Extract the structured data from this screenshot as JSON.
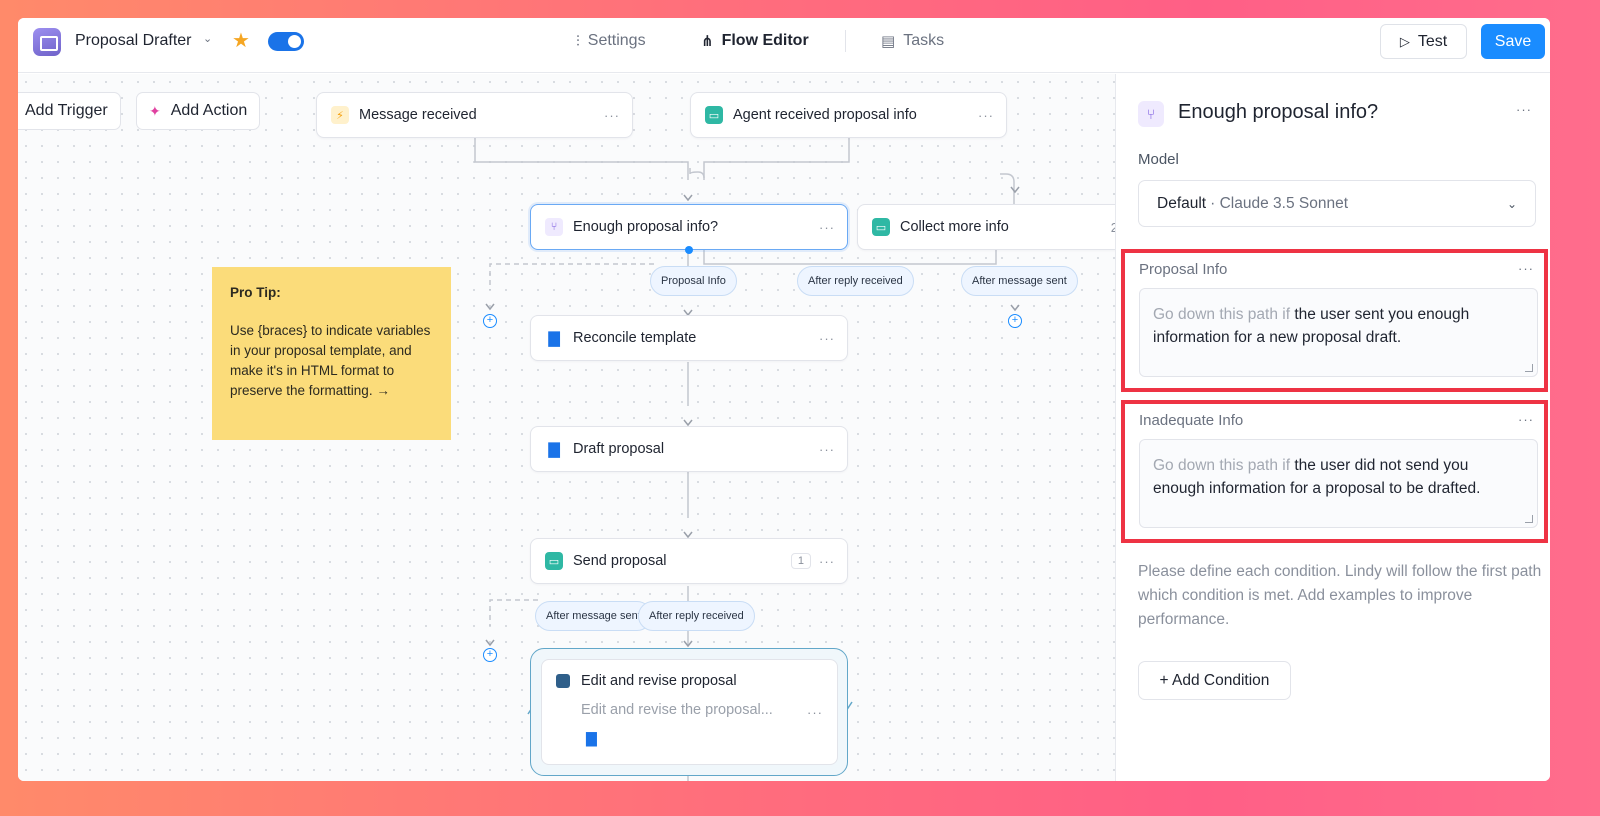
{
  "header": {
    "app_name": "Proposal Drafter",
    "nav": {
      "settings": "Settings",
      "flow_editor": "Flow Editor",
      "tasks": "Tasks"
    },
    "test_label": "Test",
    "save_label": "Save",
    "colors": {
      "primary": "#1a8cff",
      "star": "#f5a623"
    }
  },
  "toolbar": {
    "add_trigger": "Add Trigger",
    "add_action": "Add Action"
  },
  "flow": {
    "nodes": {
      "message_received": "Message received",
      "agent_received": "Agent received proposal info",
      "enough_info": "Enough proposal info?",
      "collect_more": "Collect more info",
      "reconcile": "Reconcile template",
      "draft": "Draft proposal",
      "send": "Send proposal",
      "send_count": "1",
      "edit_title": "Edit and revise proposal",
      "edit_desc": "Edit and revise the proposal..."
    },
    "pills": {
      "proposal_info": "Proposal Info",
      "after_reply_1": "After reply received",
      "after_message_1": "After message sent",
      "after_message_2": "After message sent",
      "after_reply_2": "After reply received"
    },
    "more_glyph": "···",
    "collect_more_partial_count": "2"
  },
  "pro_tip": {
    "title": "Pro Tip:",
    "body": "Use {braces} to indicate variables in your proposal template, and make it's in HTML format to preserve the formatting. →"
  },
  "panel": {
    "title": "Enough proposal info?",
    "model_label": "Model",
    "model_value": "Default",
    "model_sub": "· Claude 3.5 Sonnet",
    "conditions": [
      {
        "name": "Proposal Info",
        "hint": "Go down this path if",
        "text": "the user sent you enough information for a new proposal draft."
      },
      {
        "name": "Inadequate Info",
        "hint": "Go down this path if",
        "text": "the user did not send you enough information for a proposal to be drafted."
      }
    ],
    "help": "Please define each condition. Lindy will follow the first path which condition is met. Add examples to improve performance.",
    "add_condition": "+ Add Condition",
    "highlight_color": "#ee3344"
  }
}
